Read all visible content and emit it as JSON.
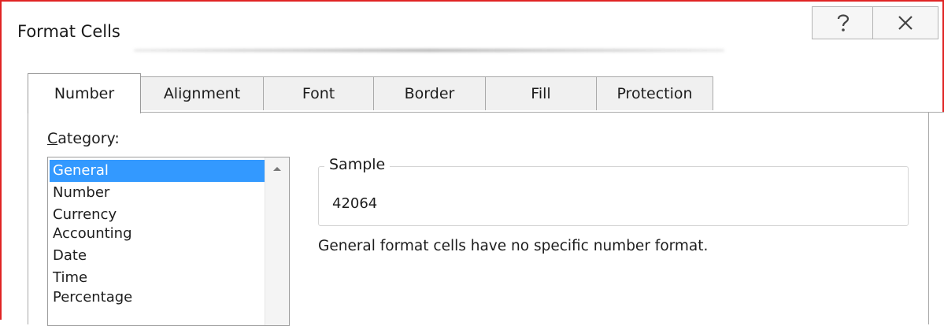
{
  "dialog": {
    "title": "Format Cells",
    "help_icon": "question-mark-icon",
    "close_icon": "close-x-icon"
  },
  "tabs": [
    {
      "label": "Number",
      "active": true
    },
    {
      "label": "Alignment",
      "active": false
    },
    {
      "label": "Font",
      "active": false
    },
    {
      "label": "Border",
      "active": false
    },
    {
      "label": "Fill",
      "active": false
    },
    {
      "label": "Protection",
      "active": false
    }
  ],
  "category": {
    "label_underlined": "C",
    "label_rest": "ategory:",
    "items": [
      "General",
      "Number",
      "Currency",
      "Accounting",
      "Date",
      "Time",
      "Percentage"
    ],
    "selected": "General"
  },
  "sample": {
    "legend": "Sample",
    "value": "42064"
  },
  "description": "General format cells have no specific number format.",
  "colors": {
    "frame_border": "#e02424",
    "selection": "#3399ff"
  }
}
